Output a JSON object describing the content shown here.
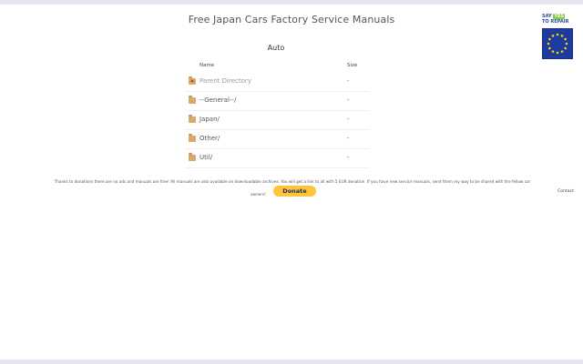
{
  "page": {
    "title": "Free Japan Cars Factory Service Manuals",
    "section_title": "Auto"
  },
  "badge": {
    "line1_a": "SAY",
    "line1_yes": "YES",
    "line2": "TO REPAIR",
    "icon": "eu-flag-icon",
    "flag_color": "#1d3aa0",
    "star_color": "#f7d000"
  },
  "table": {
    "headers": {
      "name": "Name",
      "size": "Size"
    },
    "rows": [
      {
        "name": "Parent Directory",
        "size": "-",
        "icon": "folder-up-icon"
      },
      {
        "name": "--General--/",
        "size": "-",
        "icon": "folder-icon"
      },
      {
        "name": "Japan/",
        "size": "-",
        "icon": "folder-icon"
      },
      {
        "name": "Other/",
        "size": "-",
        "icon": "folder-icon"
      },
      {
        "name": "Util/",
        "size": "-",
        "icon": "folder-icon"
      }
    ]
  },
  "footer": {
    "notice": "Thanks to donations there are no ads and manuals are free! All manuals are also available on downloadable archives. You will get a link to all with 5 EUR donation. If you have new service manuals, send them my way to be shared with the fellow car",
    "owners": "owners!",
    "donate_label": "Donate",
    "contact_label": "Contact"
  },
  "colors": {
    "folder": "#d9a96a",
    "donate": "#ffc43a",
    "top_bar": "#e6e6ee"
  }
}
